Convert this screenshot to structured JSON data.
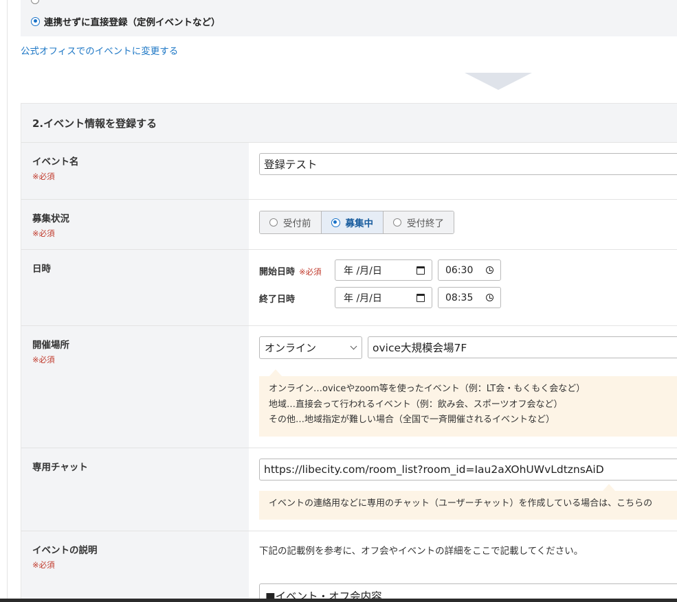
{
  "event_source": {
    "selected_option_label": "連携せずに直接登録（定例イベントなど）",
    "change_link": "公式オフィスでのイベントに変更する"
  },
  "form": {
    "section_title": "2.イベント情報を登録する",
    "required_mark": "※必須",
    "event_name": {
      "label": "イベント名",
      "value": "登録テスト"
    },
    "recruitment_status": {
      "label": "募集状況",
      "options": [
        "受付前",
        "募集中",
        "受付終了"
      ],
      "selected": "募集中"
    },
    "datetime": {
      "label": "日時",
      "start_label": "開始日時",
      "start_date_placeholder": "年 /月/日",
      "start_time": "06:30",
      "end_label": "終了日時",
      "end_date_placeholder": "年 /月/日",
      "end_time": "08:35"
    },
    "venue": {
      "label": "開催場所",
      "type_selected": "オンライン",
      "place_value": "ovice大規模会場7F",
      "hints": [
        "オンライン…oviceやzoom等を使ったイベント（例：LT会・もくもく会など）",
        "地域…直接会って行われるイベント（例：飲み会、スポーツオフ会など）",
        "その他…地域指定が難しい場合（全国で一斉開催されるイベントなど）"
      ]
    },
    "chat": {
      "label": "専用チャット",
      "value": "https://libecity.com/room_list?room_id=Iau2aXOhUWvLdtznsAiD",
      "hint": "イベントの連絡用などに専用のチャット（ユーザーチャット）を作成している場合は、こちらの"
    },
    "description": {
      "label": "イベントの説明",
      "instruction": "下記の記載例を参考に、オフ会やイベントの詳細をここで記載してください。",
      "content_first_line": "■イベント・オフ会内容"
    }
  }
}
